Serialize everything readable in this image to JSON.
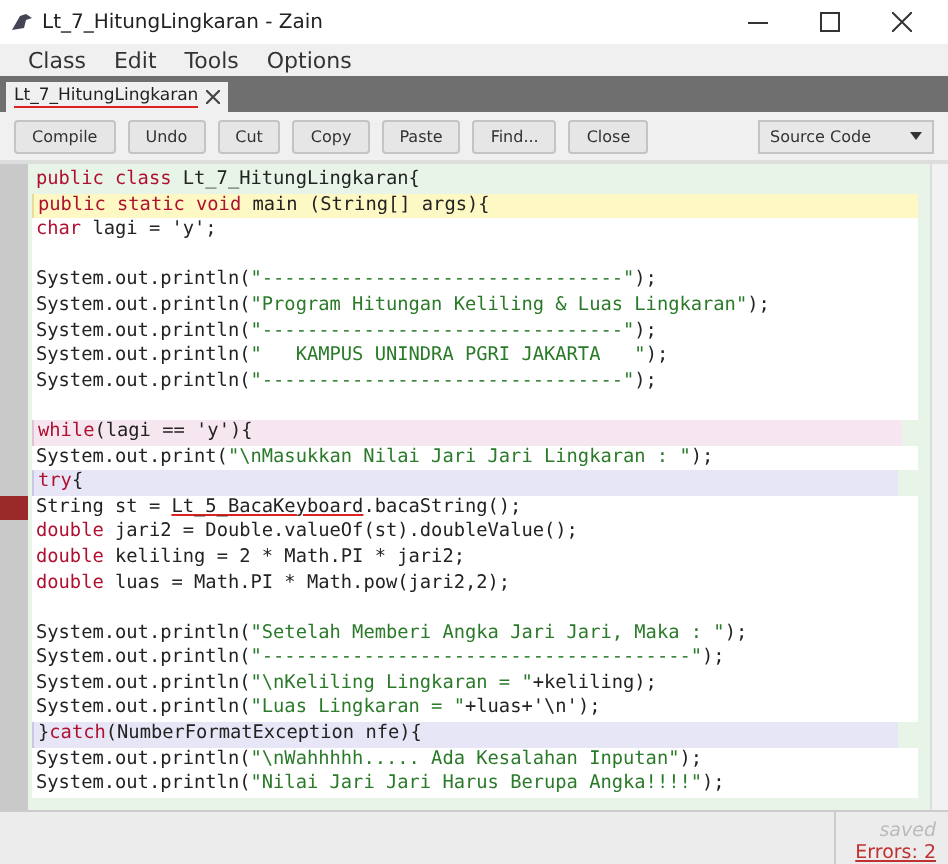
{
  "window": {
    "title": "Lt_7_HitungLingkaran - Zain"
  },
  "menu": [
    "Class",
    "Edit",
    "Tools",
    "Options"
  ],
  "tabs": [
    {
      "label": "Lt_7_HitungLingkaran",
      "selected": true
    }
  ],
  "toolbar": {
    "buttons": [
      "Compile",
      "Undo",
      "Cut",
      "Copy",
      "Paste",
      "Find...",
      "Close"
    ],
    "view_select": "Source Code"
  },
  "code": [
    {
      "kind": "class",
      "error": false,
      "tokens": [
        {
          "kind": "keyword",
          "text": "public class "
        },
        {
          "kind": "plain",
          "text": "Lt_7_HitungLingkaran{"
        }
      ]
    },
    {
      "kind": "method",
      "error": false,
      "tokens": [
        {
          "kind": "keyword",
          "text": "public static void "
        },
        {
          "kind": "plain",
          "text": "main (String[] args){"
        }
      ]
    },
    {
      "kind": "body",
      "error": false,
      "tokens": [
        {
          "kind": "keyword",
          "text": "char "
        },
        {
          "kind": "plain",
          "text": "lagi = 'y';"
        }
      ]
    },
    {
      "kind": "body",
      "error": false
    },
    {
      "kind": "body",
      "error": false,
      "tokens": [
        {
          "kind": "plain",
          "text": "System.out.println("
        },
        {
          "kind": "string",
          "text": "\"--------------------------------\""
        },
        {
          "kind": "plain",
          "text": ");"
        }
      ]
    },
    {
      "kind": "body",
      "error": false,
      "tokens": [
        {
          "kind": "plain",
          "text": "System.out.println("
        },
        {
          "kind": "string",
          "text": "\"Program Hitungan Keliling & Luas Lingkaran\""
        },
        {
          "kind": "plain",
          "text": ");"
        }
      ]
    },
    {
      "kind": "body",
      "error": false,
      "tokens": [
        {
          "kind": "plain",
          "text": "System.out.println("
        },
        {
          "kind": "string",
          "text": "\"--------------------------------\""
        },
        {
          "kind": "plain",
          "text": ");"
        }
      ]
    },
    {
      "kind": "body",
      "error": false,
      "tokens": [
        {
          "kind": "plain",
          "text": "System.out.println("
        },
        {
          "kind": "string",
          "text": "\"   KAMPUS UNINDRA PGRI JAKARTA   \""
        },
        {
          "kind": "plain",
          "text": ");"
        }
      ]
    },
    {
      "kind": "body",
      "error": false,
      "tokens": [
        {
          "kind": "plain",
          "text": "System.out.println("
        },
        {
          "kind": "string",
          "text": "\"--------------------------------\""
        },
        {
          "kind": "plain",
          "text": ");"
        }
      ]
    },
    {
      "kind": "body",
      "error": false
    },
    {
      "kind": "while",
      "error": false,
      "tokens": [
        {
          "kind": "keyword",
          "text": "while"
        },
        {
          "kind": "plain",
          "text": "(lagi == 'y'){"
        }
      ]
    },
    {
      "kind": "body",
      "error": false,
      "tokens": [
        {
          "kind": "plain",
          "text": "System.out.print("
        },
        {
          "kind": "string",
          "text": "\"\\nMasukkan Nilai Jari Jari Lingkaran : \""
        },
        {
          "kind": "plain",
          "text": ");"
        }
      ]
    },
    {
      "kind": "try",
      "error": false,
      "tokens": [
        {
          "kind": "keyword",
          "text": "try"
        },
        {
          "kind": "plain",
          "text": "{"
        }
      ]
    },
    {
      "kind": "body",
      "error": true,
      "tokens": [
        {
          "kind": "plain",
          "text": "String st = "
        },
        {
          "kind": "error",
          "text": "Lt_5_BacaKeyboard"
        },
        {
          "kind": "plain",
          "text": ".bacaString();"
        }
      ]
    },
    {
      "kind": "body",
      "error": false,
      "tokens": [
        {
          "kind": "keyword",
          "text": "double "
        },
        {
          "kind": "plain",
          "text": "jari2 = Double.valueOf(st).doubleValue();"
        }
      ]
    },
    {
      "kind": "body",
      "error": false,
      "tokens": [
        {
          "kind": "keyword",
          "text": "double "
        },
        {
          "kind": "plain",
          "text": "keliling = 2 * Math.PI * jari2;"
        }
      ]
    },
    {
      "kind": "body",
      "error": false,
      "tokens": [
        {
          "kind": "keyword",
          "text": "double "
        },
        {
          "kind": "plain",
          "text": "luas = Math.PI * Math.pow(jari2,2);"
        }
      ]
    },
    {
      "kind": "body",
      "error": false
    },
    {
      "kind": "body",
      "error": false,
      "tokens": [
        {
          "kind": "plain",
          "text": "System.out.println("
        },
        {
          "kind": "string",
          "text": "\"Setelah Memberi Angka Jari Jari, Maka : \""
        },
        {
          "kind": "plain",
          "text": ");"
        }
      ]
    },
    {
      "kind": "body",
      "error": false,
      "tokens": [
        {
          "kind": "plain",
          "text": "System.out.println("
        },
        {
          "kind": "string",
          "text": "\"--------------------------------------\""
        },
        {
          "kind": "plain",
          "text": ");"
        }
      ]
    },
    {
      "kind": "body",
      "error": false,
      "tokens": [
        {
          "kind": "plain",
          "text": "System.out.println("
        },
        {
          "kind": "string",
          "text": "\"\\nKeliling Lingkaran = \""
        },
        {
          "kind": "plain",
          "text": "+keliling);"
        }
      ]
    },
    {
      "kind": "body",
      "error": false,
      "tokens": [
        {
          "kind": "plain",
          "text": "System.out.println("
        },
        {
          "kind": "string",
          "text": "\"Luas Lingkaran = \""
        },
        {
          "kind": "plain",
          "text": "+luas+'\\n');"
        }
      ]
    },
    {
      "kind": "try",
      "error": false,
      "tokens": [
        {
          "kind": "plain",
          "text": "}"
        },
        {
          "kind": "keyword",
          "text": "catch"
        },
        {
          "kind": "plain",
          "text": "(NumberFormatException nfe){"
        }
      ]
    },
    {
      "kind": "body",
      "error": false,
      "tokens": [
        {
          "kind": "plain",
          "text": "System.out.println("
        },
        {
          "kind": "string",
          "text": "\"\\nWahhhhh..... Ada Kesalahan Inputan\""
        },
        {
          "kind": "plain",
          "text": ");"
        }
      ]
    },
    {
      "kind": "body",
      "error": false,
      "tokens": [
        {
          "kind": "plain",
          "text": "System.out.println("
        },
        {
          "kind": "string",
          "text": "\"Nilai Jari Jari Harus Berupa Angka!!!!\""
        },
        {
          "kind": "plain",
          "text": ");"
        }
      ]
    }
  ],
  "status": {
    "state": "saved",
    "errors": "Errors: 2"
  }
}
